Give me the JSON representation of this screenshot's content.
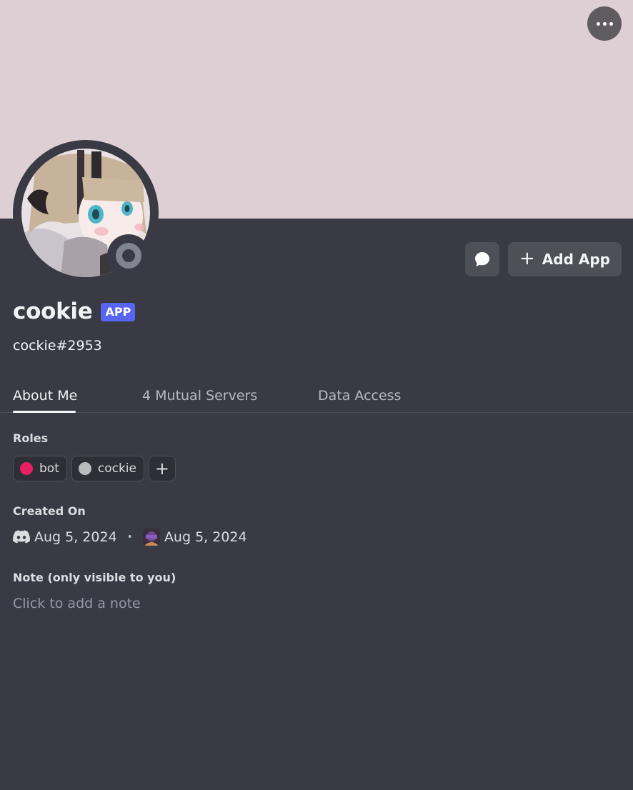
{
  "banner": {
    "color": "#decfd4",
    "more_icon": "more-horizontal-icon"
  },
  "profile": {
    "display_name": "cookie",
    "badge": "APP",
    "username": "cockie#2953",
    "status": "offline"
  },
  "actions": {
    "message_icon": "chat-bubble-icon",
    "add_app_label": "Add App"
  },
  "tabs": [
    {
      "label": "About Me",
      "active": true
    },
    {
      "label": "4 Mutual Servers",
      "active": false
    },
    {
      "label": "Data Access",
      "active": false
    }
  ],
  "roles_section": {
    "title": "Roles",
    "roles": [
      {
        "name": "bot",
        "color": "#e91e63"
      },
      {
        "name": "cockie",
        "color": "#b9bbbe"
      }
    ],
    "add_icon": "plus-icon"
  },
  "created_section": {
    "title": "Created On",
    "discord_date": "Aug 5, 2024",
    "server_date": "Aug 5, 2024"
  },
  "note_section": {
    "title": "Note (only visible to you)",
    "placeholder": "Click to add a note"
  }
}
